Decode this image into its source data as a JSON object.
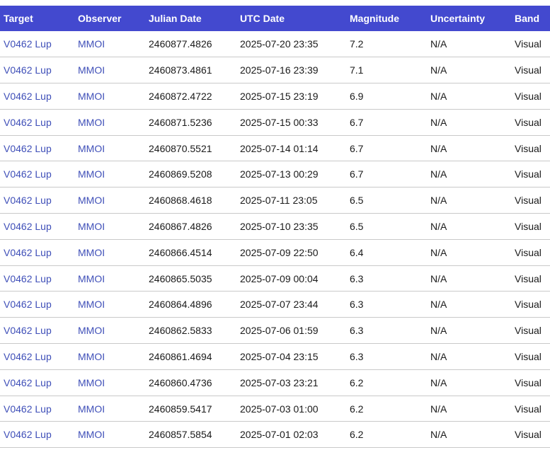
{
  "table": {
    "headers": [
      "Target",
      "Observer",
      "Julian Date",
      "UTC Date",
      "Magnitude",
      "Uncertainty",
      "Band"
    ],
    "rows": [
      [
        "V0462 Lup",
        "MMOI",
        "2460877.4826",
        "2025-07-20 23:35",
        "7.2",
        "N/A",
        "Visual"
      ],
      [
        "V0462 Lup",
        "MMOI",
        "2460873.4861",
        "2025-07-16 23:39",
        "7.1",
        "N/A",
        "Visual"
      ],
      [
        "V0462 Lup",
        "MMOI",
        "2460872.4722",
        "2025-07-15 23:19",
        "6.9",
        "N/A",
        "Visual"
      ],
      [
        "V0462 Lup",
        "MMOI",
        "2460871.5236",
        "2025-07-15 00:33",
        "6.7",
        "N/A",
        "Visual"
      ],
      [
        "V0462 Lup",
        "MMOI",
        "2460870.5521",
        "2025-07-14 01:14",
        "6.7",
        "N/A",
        "Visual"
      ],
      [
        "V0462 Lup",
        "MMOI",
        "2460869.5208",
        "2025-07-13 00:29",
        "6.7",
        "N/A",
        "Visual"
      ],
      [
        "V0462 Lup",
        "MMOI",
        "2460868.4618",
        "2025-07-11 23:05",
        "6.5",
        "N/A",
        "Visual"
      ],
      [
        "V0462 Lup",
        "MMOI",
        "2460867.4826",
        "2025-07-10 23:35",
        "6.5",
        "N/A",
        "Visual"
      ],
      [
        "V0462 Lup",
        "MMOI",
        "2460866.4514",
        "2025-07-09 22:50",
        "6.4",
        "N/A",
        "Visual"
      ],
      [
        "V0462 Lup",
        "MMOI",
        "2460865.5035",
        "2025-07-09 00:04",
        "6.3",
        "N/A",
        "Visual"
      ],
      [
        "V0462 Lup",
        "MMOI",
        "2460864.4896",
        "2025-07-07 23:44",
        "6.3",
        "N/A",
        "Visual"
      ],
      [
        "V0462 Lup",
        "MMOI",
        "2460862.5833",
        "2025-07-06 01:59",
        "6.3",
        "N/A",
        "Visual"
      ],
      [
        "V0462 Lup",
        "MMOI",
        "2460861.4694",
        "2025-07-04 23:15",
        "6.3",
        "N/A",
        "Visual"
      ],
      [
        "V0462 Lup",
        "MMOI",
        "2460860.4736",
        "2025-07-03 23:21",
        "6.2",
        "N/A",
        "Visual"
      ],
      [
        "V0462 Lup",
        "MMOI",
        "2460859.5417",
        "2025-07-03 01:00",
        "6.2",
        "N/A",
        "Visual"
      ],
      [
        "V0462 Lup",
        "MMOI",
        "2460857.5854",
        "2025-07-01 02:03",
        "6.2",
        "N/A",
        "Visual"
      ]
    ]
  },
  "colors": {
    "header_bg": "#4349cf",
    "header_text": "#ffffff",
    "link": "#3f4fb8",
    "row_border": "#c9c9c9"
  }
}
